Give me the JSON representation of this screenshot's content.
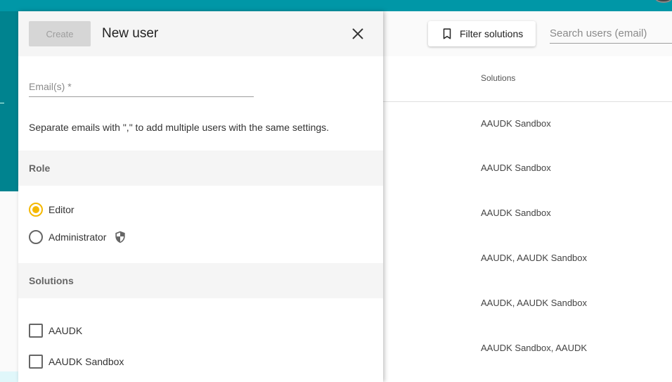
{
  "toolbar": {
    "filter_label": "Filter solutions",
    "search_placeholder": "Search users (email)"
  },
  "table": {
    "column_header": "Solutions",
    "rows": [
      "AAUDK Sandbox",
      "AAUDK Sandbox",
      "AAUDK Sandbox",
      "AAUDK, AAUDK Sandbox",
      "AAUDK, AAUDK Sandbox",
      "AAUDK Sandbox, AAUDK"
    ]
  },
  "dialog": {
    "create_label": "Create",
    "title": "New user",
    "email_label": "Email(s) *",
    "hint": "Separate emails with \",\" to add multiple users with the same settings.",
    "role_heading": "Role",
    "roles": [
      {
        "label": "Editor",
        "selected": true
      },
      {
        "label": "Administrator",
        "selected": false
      }
    ],
    "solutions_heading": "Solutions",
    "solutions": [
      {
        "label": "AAUDK",
        "checked": false
      },
      {
        "label": "AAUDK Sandbox",
        "checked": false
      }
    ]
  },
  "colors": {
    "accent_teal": "#0097a7",
    "radio_selected": "#f5b800"
  },
  "icons": [
    "bookmark-icon",
    "close-icon",
    "shield-icon"
  ]
}
